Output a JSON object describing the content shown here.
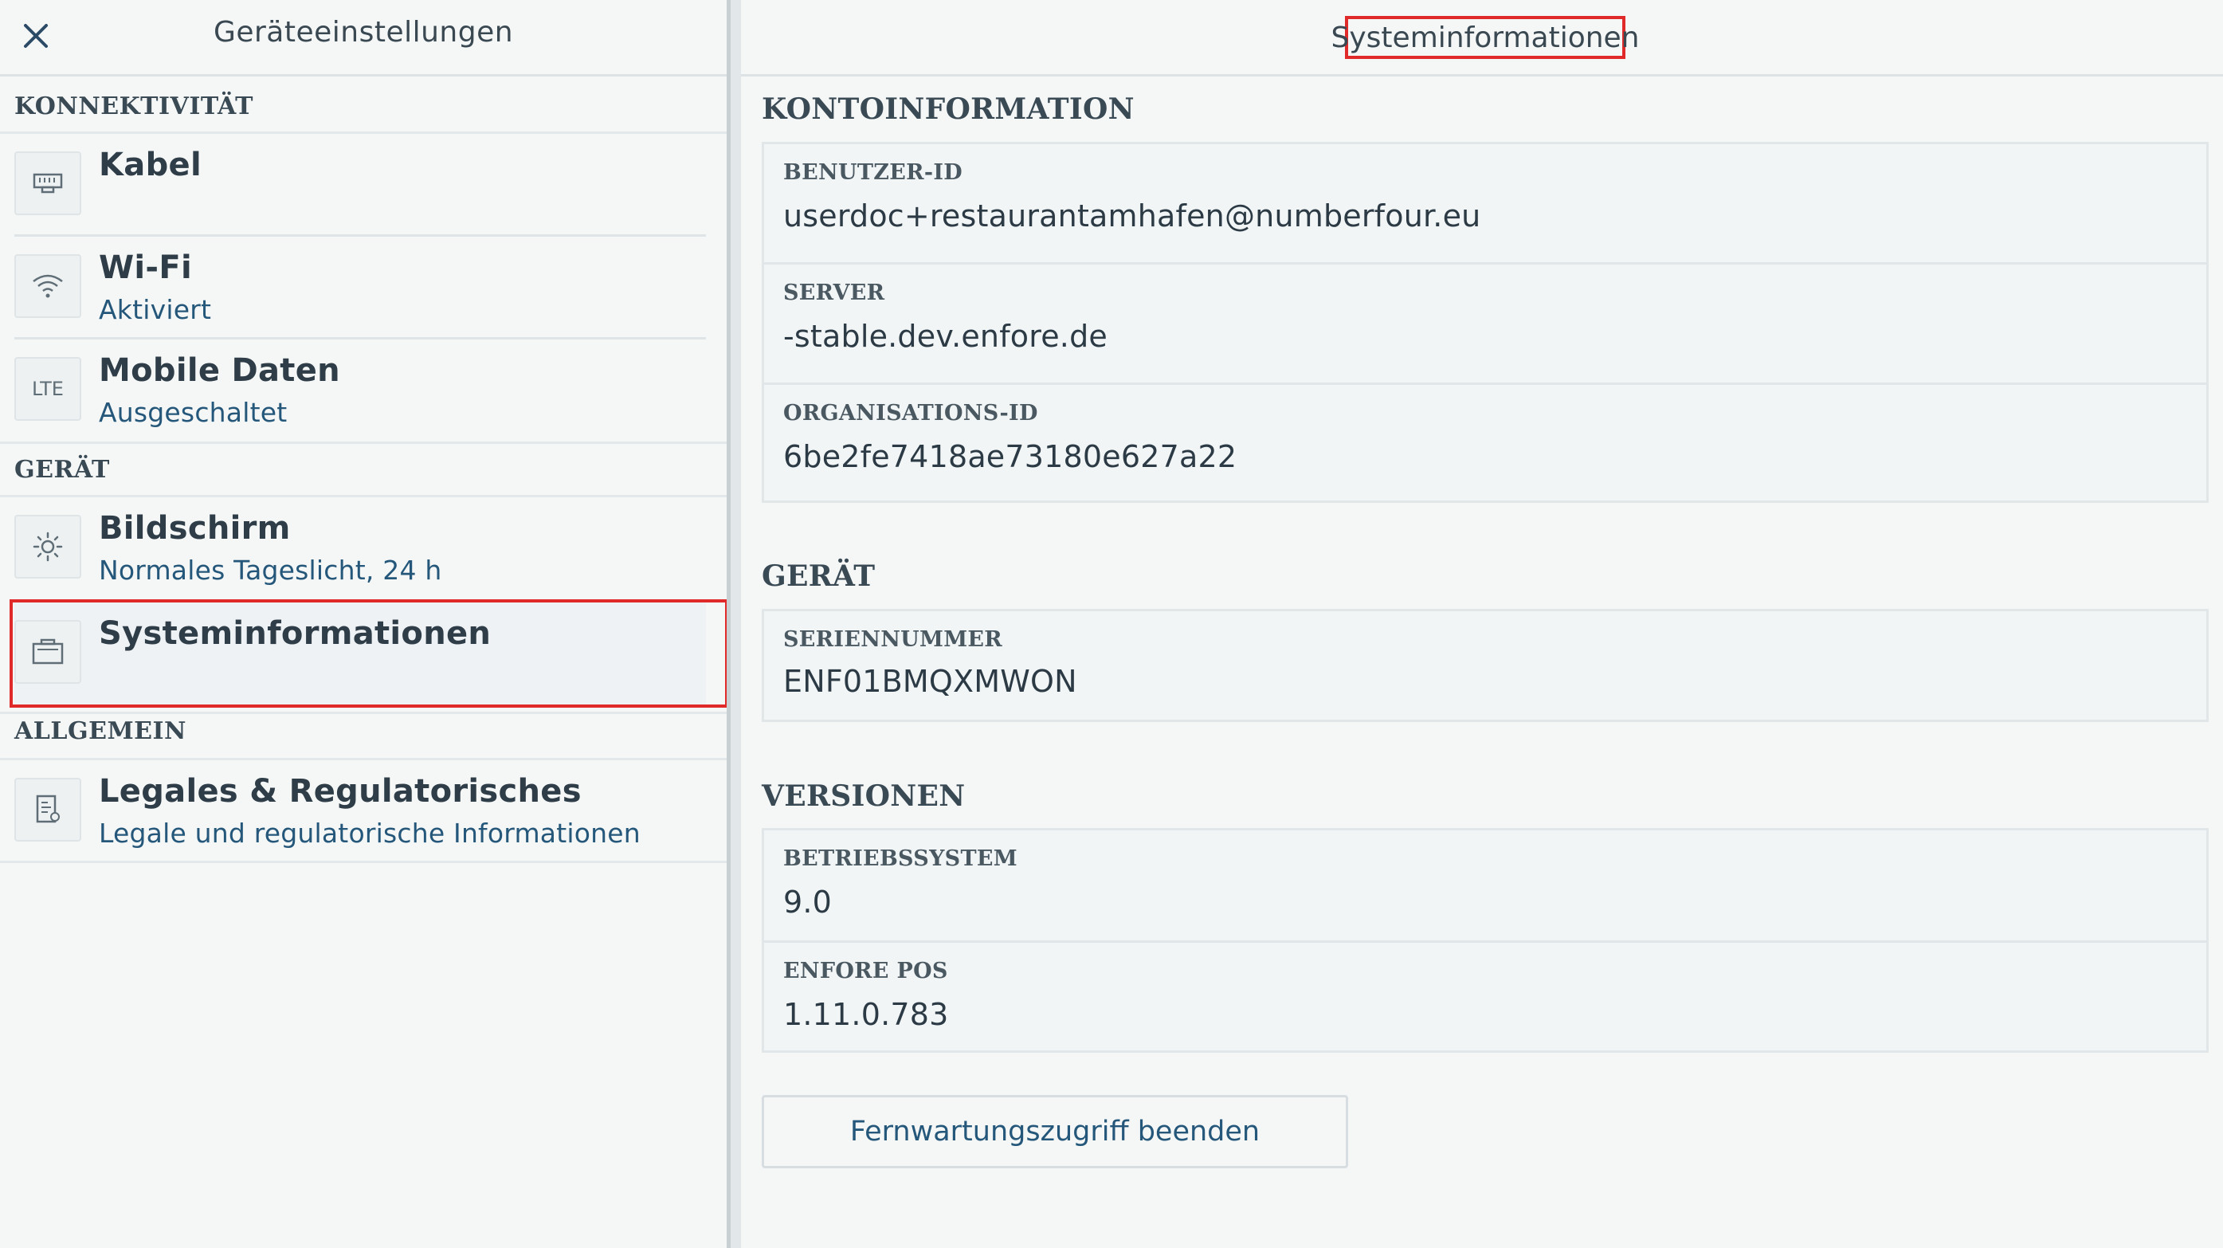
{
  "left": {
    "title": "Geräteeinstellungen",
    "close_icon": "close-icon",
    "sections": {
      "connectivity": "KONNEKTIVITÄT",
      "device": "GERÄT",
      "general": "ALLGEMEIN"
    },
    "items": {
      "cable": {
        "title": "Kabel",
        "subtitle": "",
        "icon": "ethernet-icon"
      },
      "wifi": {
        "title": "Wi-Fi",
        "subtitle": "Aktiviert",
        "icon": "wifi-icon"
      },
      "mobile": {
        "title": "Mobile Daten",
        "subtitle": "Ausgeschaltet",
        "icon": "lte-icon",
        "icon_text": "LTE"
      },
      "display": {
        "title": "Bildschirm",
        "subtitle": "Normales Tageslicht, 24 h",
        "icon": "brightness-icon"
      },
      "sysinfo": {
        "title": "Systeminformationen",
        "subtitle": "",
        "icon": "device-info-icon"
      },
      "legal": {
        "title": "Legales & Regulatorisches",
        "subtitle": "Legale und regulatorische Informationen",
        "icon": "document-icon"
      }
    }
  },
  "right": {
    "title": "Systeminformationen",
    "account": {
      "heading": "KONTOINFORMATION",
      "user_id_label": "BENUTZER-ID",
      "user_id_value": "userdoc+restaurantamhafen@numberfour.eu",
      "server_label": "SERVER",
      "server_value": "-stable.dev.enfore.de",
      "org_label": "ORGANISATIONS-ID",
      "org_value": "6be2fe7418ae73180e627a22"
    },
    "device": {
      "heading": "GERÄT",
      "serial_label": "SERIENNUMMER",
      "serial_value": "ENF01BMQXMWON"
    },
    "versions": {
      "heading": "VERSIONEN",
      "os_label": "BETRIEBSSYSTEM",
      "os_value": "9.0",
      "pos_label": "ENFORE POS",
      "pos_value": "1.11.0.783"
    },
    "action_button": "Fernwartungszugriff beenden"
  },
  "colors": {
    "accent_text": "#24577a",
    "highlight": "#e02a2a",
    "background": "#f5f7f7"
  }
}
